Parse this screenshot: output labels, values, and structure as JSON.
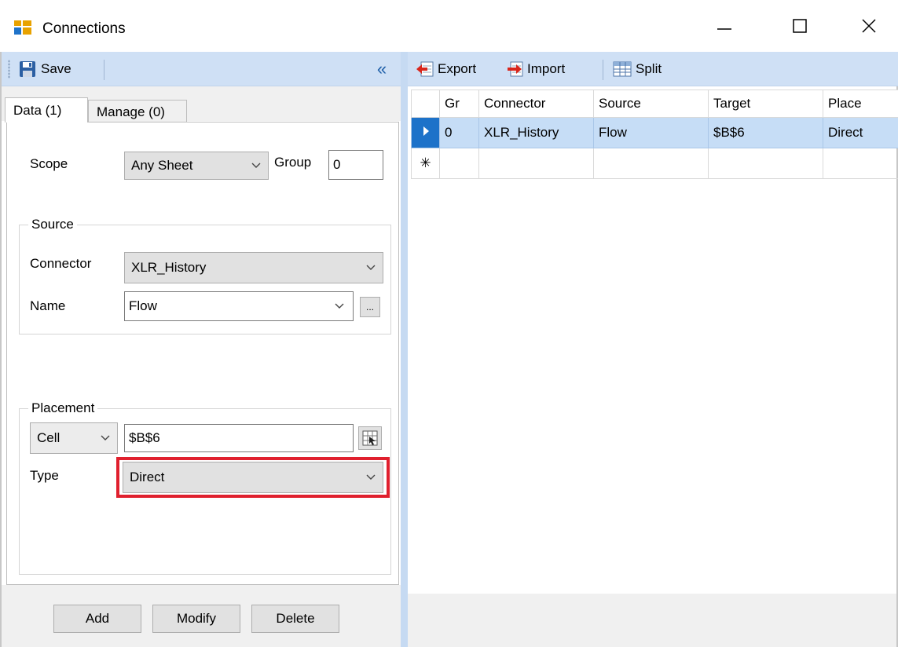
{
  "window": {
    "title": "Connections"
  },
  "left_toolbar": {
    "save_label": "Save",
    "collapse_glyph": "«"
  },
  "right_toolbar": {
    "export_label": "Export",
    "import_label": "Import",
    "split_label": "Split"
  },
  "tabs": [
    {
      "label": "Data (1)",
      "active": true
    },
    {
      "label": "Manage (0)",
      "active": false
    }
  ],
  "form": {
    "scope": {
      "label": "Scope",
      "value": "Any Sheet"
    },
    "group": {
      "label": "Group",
      "value": "0"
    },
    "source": {
      "title": "Source",
      "connector": {
        "label": "Connector",
        "value": "XLR_History"
      },
      "name": {
        "label": "Name",
        "value": "Flow",
        "browse_label": "..."
      }
    },
    "placement": {
      "title": "Placement",
      "mode": {
        "value": "Cell"
      },
      "address": {
        "value": "$B$6"
      },
      "type": {
        "label": "Type",
        "value": "Direct"
      }
    }
  },
  "buttons": {
    "add": "Add",
    "modify": "Modify",
    "delete": "Delete"
  },
  "grid": {
    "columns": [
      "Gr",
      "Connector",
      "Source",
      "Target",
      "Place"
    ],
    "rows": [
      {
        "group": "0",
        "connector": "XLR_History",
        "source": "Flow",
        "target": "$B$6",
        "place": "Direct"
      }
    ],
    "new_row_marker": "✳"
  },
  "icons": {
    "app": "connections-app-icon",
    "save": "floppy-disk-icon",
    "export": "export-icon",
    "import": "import-icon",
    "split": "table-split-icon",
    "cell_picker": "cell-picker-icon"
  },
  "colors": {
    "toolbar": "#cfe0f5",
    "selection": "#c6ddf6",
    "row_indicator": "#1d72c9",
    "highlight": "#e0202e"
  }
}
